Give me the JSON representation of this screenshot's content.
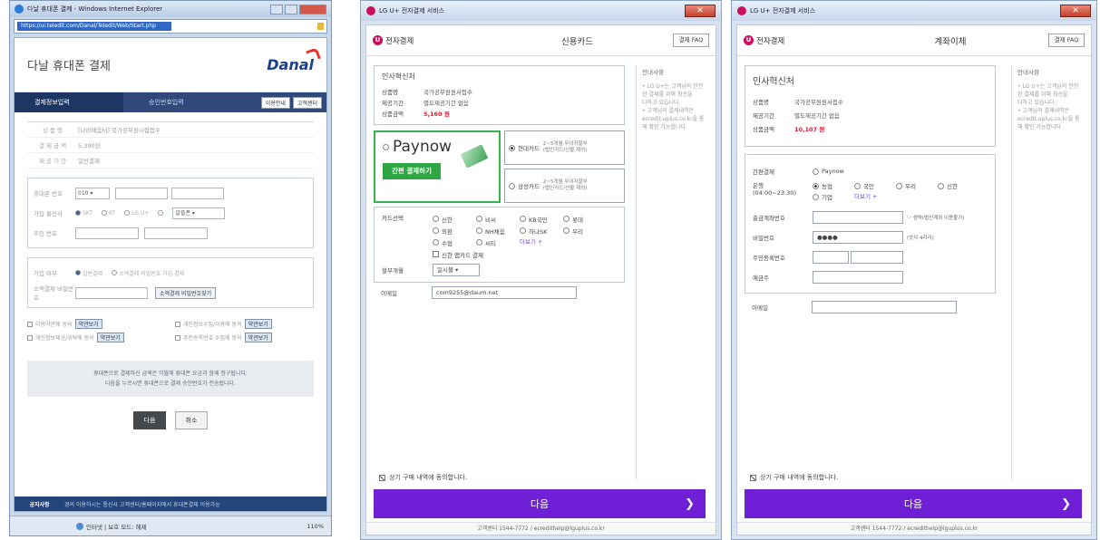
{
  "danal": {
    "window_title": "다날 휴대폰 결제 - Windows Internet Explorer",
    "url": "https://ui.teledit.com/Danal/Teledit/Web/Start.php",
    "header_title": "다날 휴대폰 결제",
    "logo": "Danal",
    "step1": "결제정보입력",
    "step2": "승인번호입력",
    "help_btn1": "이용안내",
    "help_btn2": "고객센터",
    "product_rows": [
      {
        "k": "상 품 명",
        "v": "[나라배움터] 국가공무원시험접수"
      },
      {
        "k": "결 제 금 액",
        "v": "5,390원"
      },
      {
        "k": "제 공 기 간",
        "v": "일반결제"
      }
    ],
    "phone_label": "휴대폰 번호",
    "phone_prefix": "010",
    "carrier_label": "가입 통신사",
    "carriers": [
      "SKT",
      "KT",
      "LG U+",
      "알뜰폰"
    ],
    "carrier_select": "알뜰폰",
    "ssn_label": "주민 번호",
    "pay_type_label": "가입 여부",
    "pay_type_opt1": "일반결제",
    "pay_type_opt2": "소액결제 비밀번호 가입 결제",
    "pw_label": "소액결제 비밀번호",
    "pw_btn": "소액결제 비밀번호찾기",
    "agreements": [
      [
        "이용약관에 동의",
        "개인정보수집/이용에 동의"
      ],
      [
        "개인정보제공/위탁에 동의",
        "주민등록번호 수집에 동의"
      ]
    ],
    "view_label": "약관보기",
    "notice_line1": "휴대폰으로 결제하신 금액은 익월에 휴대폰 요금과 함께 청구됩니다.",
    "notice_line2": "다음을 누르시면 휴대폰으로 결제 승인번호가 전송됩니다.",
    "next_btn": "다음",
    "cancel_btn": "취소",
    "foot_key": "공지사항",
    "foot_text": "경의 이용하시는 통신사 고객센터/홈페이지에서 휴대폰결제 이용가능",
    "status_text": "인터넷 | 보호 모드: 해제",
    "zoom": "110%"
  },
  "card": {
    "window_title": "LG U+ 전자결제 서비스",
    "logo": "전자결제",
    "title": "신용카드",
    "faq": "결제 FAQ",
    "section_title": "인사혁신처",
    "rows": [
      {
        "k": "상품명",
        "v": "국가공무원원서접수"
      },
      {
        "k": "제공기간",
        "v": "별도제공기간 없음"
      },
      {
        "k": "상품금액",
        "v": "5,160 원"
      }
    ],
    "paynow": "Paynow",
    "paynow_btn": "간편 결제하기",
    "card_opts": [
      {
        "name": "현대카드",
        "desc1": "2~5개월 무이자할부",
        "desc2": "(법인카드/선불 제외)"
      },
      {
        "name": "삼성카드",
        "desc1": "2~5개월 무이자할부",
        "desc2": "(법인카드/선불 제외)"
      }
    ],
    "card_select_label": "카드선택",
    "card_list": [
      [
        "신한",
        "비씨",
        "KB국민",
        "롯데"
      ],
      [
        "외환",
        "NH채움",
        "하나SK",
        "우리"
      ],
      [
        "수협",
        "씨티",
        "더보기 +",
        ""
      ]
    ],
    "etc_card": "신한 앱카드 결제",
    "installment_label": "할부개월",
    "installment_value": "일시불",
    "email_label": "이메일",
    "email_value": "com9255@daum.net",
    "side_title": "안내사항",
    "side_lines": [
      "• LG U+는 고객님의 안전",
      "한 결제를 위해 최선을",
      "다하고 있습니다.",
      "• 고객님의 결제내역은",
      "ecredit.uplus.co.kr을 통",
      "해 확인 가능합니다."
    ],
    "agree_text": "상기 구매 내역에 동의합니다.",
    "next": "다음",
    "footer": "고객센터 1544-7772 / ecredithelp@lguplus.co.kr"
  },
  "bank": {
    "window_title": "LG U+ 전자결제 서비스",
    "logo": "전자결제",
    "title": "계좌이체",
    "faq": "결제 FAQ",
    "section_title": "인사혁신처",
    "rows": [
      {
        "k": "상품명",
        "v": "국가공무원원서접수"
      },
      {
        "k": "제공기간",
        "v": "별도제공기간 없음"
      },
      {
        "k": "상품금액",
        "v": "10,107 원"
      }
    ],
    "easy_label": "간편결제",
    "easy_value": "Paynow",
    "bank_label": "은행",
    "bank_hours": "(04:00~23:30)",
    "banks": [
      [
        "농협",
        "국민",
        "우리",
        "신한"
      ],
      [
        "기업",
        "더보기 +",
        "",
        ""
      ]
    ],
    "acct_label": "출금계좌번호",
    "acct_hint": "'-' 생략(법인계좌 이용불가)",
    "pw_label": "비밀번호",
    "pw_value": "●●●●",
    "pw_hint": "(숫자 4자리)",
    "ssn_label": "주민등록번호",
    "holder_label": "예금주",
    "email_label": "이메일",
    "side_title": "안내사항",
    "side_lines": [
      "• LG U+는 고객님의 안전",
      "한 결제를 위해 최선을",
      "다하고 있습니다.",
      "• 고객님의 결제내역은",
      "ecredit.uplus.co.kr을 통",
      "해 확인 가능합니다."
    ],
    "agree_text": "상기 구매 내역에 동의합니다.",
    "next": "다음",
    "footer": "고객센터 1544-7772 / ecredithelp@lguplus.co.kr"
  },
  "colors": {
    "lg_purple": "#6f1fd6",
    "paynow_green": "#2fa644",
    "danal_navy": "#23457a",
    "price_red": "#e6152b"
  }
}
